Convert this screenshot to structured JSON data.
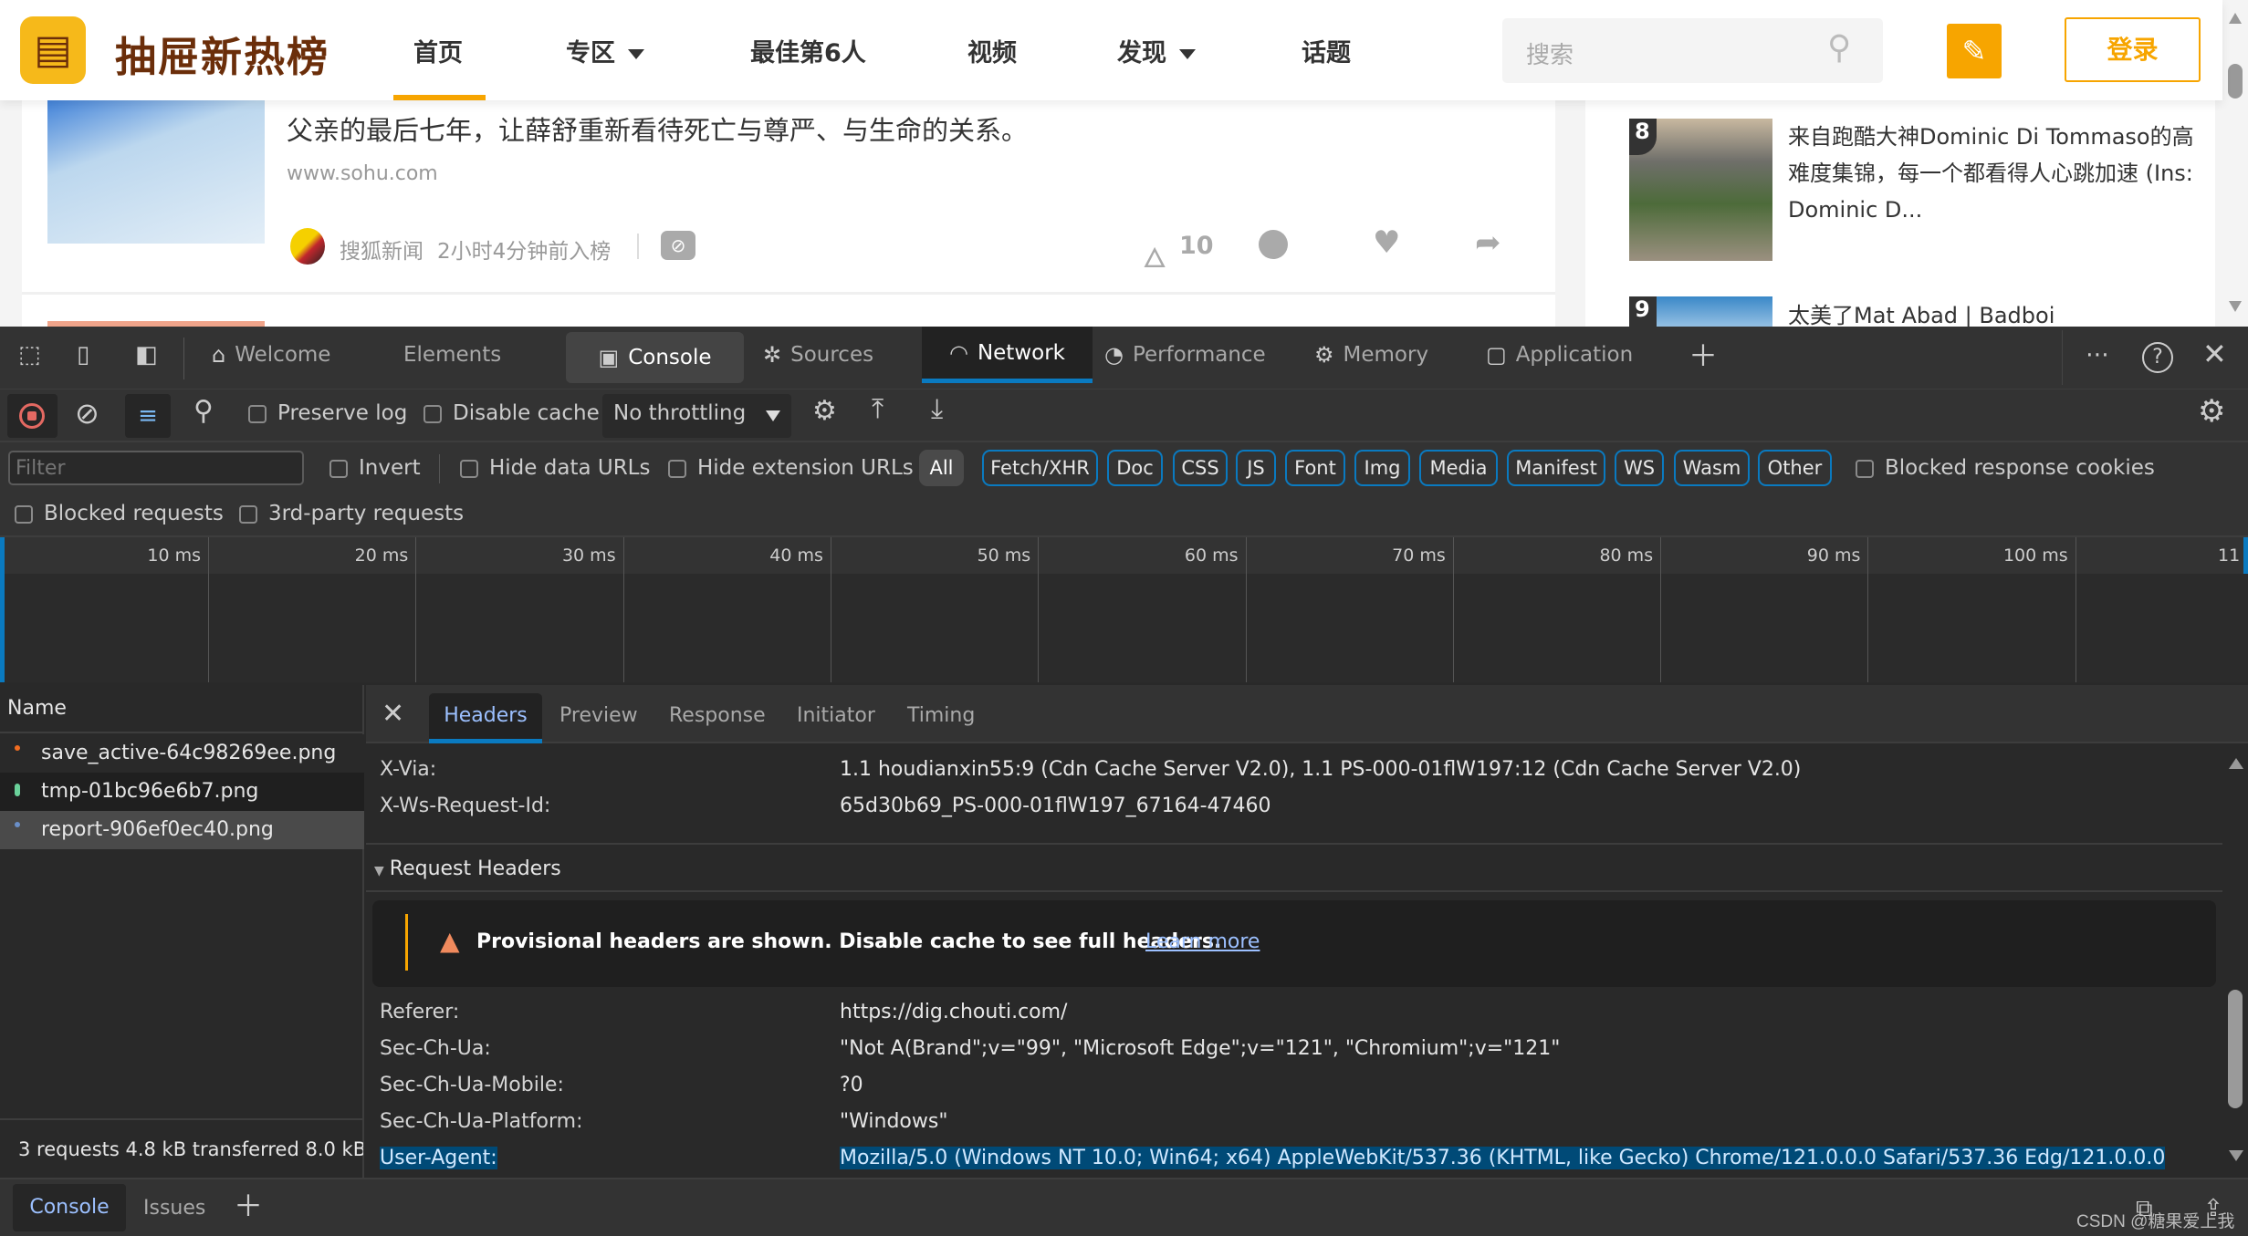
{
  "site": {
    "logo_text": "抽屉新热榜",
    "nav": [
      {
        "label": "首页",
        "active": true
      },
      {
        "label": "专区",
        "dropdown": true
      },
      {
        "label": "最佳第6人"
      },
      {
        "label": "视频"
      },
      {
        "label": "发现",
        "dropdown": true
      },
      {
        "label": "话题"
      }
    ],
    "search_placeholder": "搜索",
    "login_label": "登录",
    "accent_color": "#f7a500",
    "article": {
      "title": "父亲的最后七年，让薛舒重新看待死亡与尊严、与生命的关系。",
      "domain": "www.sohu.com",
      "source": "搜狐新闻",
      "time": "2小时4分钟前入榜",
      "likes": "10"
    },
    "side_items": [
      {
        "rank": "8",
        "title": "来自跑酷大神Dominic Di Tommaso的高难度集锦，每一个都看得人心跳加速 (Ins: Dominic D..."
      },
      {
        "rank": "9",
        "title": "太美了Mat Abad | Badboi"
      }
    ]
  },
  "devtools": {
    "tabs": [
      {
        "label": "Welcome",
        "icon": "home-icon"
      },
      {
        "label": "Elements",
        "icon": "code-icon"
      },
      {
        "label": "Console",
        "icon": "console-warning-icon"
      },
      {
        "label": "Sources",
        "icon": "bug-icon"
      },
      {
        "label": "Network",
        "icon": "wifi-icon",
        "active": true
      },
      {
        "label": "Performance",
        "icon": "gauge-icon"
      },
      {
        "label": "Memory",
        "icon": "chip-icon"
      },
      {
        "label": "Application",
        "icon": "app-icon"
      }
    ],
    "toolbar": {
      "preserve_log": "Preserve log",
      "disable_cache": "Disable cache",
      "throttling": "No throttling"
    },
    "filter": {
      "placeholder": "Filter",
      "invert": "Invert",
      "hide_data_urls": "Hide data URLs",
      "hide_extension_urls": "Hide extension URLs",
      "types": [
        "All",
        "Fetch/XHR",
        "Doc",
        "CSS",
        "JS",
        "Font",
        "Img",
        "Media",
        "Manifest",
        "WS",
        "Wasm",
        "Other"
      ],
      "blocked_response_cookies": "Blocked response cookies",
      "blocked_requests": "Blocked requests",
      "third_party": "3rd-party requests"
    },
    "timeline_ticks": [
      "10 ms",
      "20 ms",
      "30 ms",
      "40 ms",
      "50 ms",
      "60 ms",
      "70 ms",
      "80 ms",
      "90 ms",
      "100 ms",
      "11"
    ],
    "requests": {
      "header": "Name",
      "items": [
        {
          "name": "save_active-64c98269ee.png",
          "status_color": "#f26d21"
        },
        {
          "name": "tmp-01bc96e6b7.png",
          "status_color": "#6ad19a"
        },
        {
          "name": "report-906ef0ec40.png",
          "status_color": "#6a8fc8",
          "selected": true
        }
      ],
      "summary": "3 requests  4.8 kB transferred  8.0 kB"
    },
    "detail_tabs": [
      "Headers",
      "Preview",
      "Response",
      "Initiator",
      "Timing"
    ],
    "response_headers": [
      {
        "name": "X-Via:",
        "value": "1.1 houdianxin55:9 (Cdn Cache Server V2.0), 1.1 PS-000-01flW197:12 (Cdn Cache Server V2.0)"
      },
      {
        "name": "X-Ws-Request-Id:",
        "value": "65d30b69_PS-000-01flW197_67164-47460"
      }
    ],
    "request_section": "Request Headers",
    "provisional": {
      "text": "Provisional headers are shown. Disable cache to see full headers.",
      "link": "Learn more"
    },
    "request_headers": [
      {
        "name": "Referer:",
        "value": "https://dig.chouti.com/"
      },
      {
        "name": "Sec-Ch-Ua:",
        "value": "\"Not A(Brand\";v=\"99\", \"Microsoft Edge\";v=\"121\", \"Chromium\";v=\"121\""
      },
      {
        "name": "Sec-Ch-Ua-Mobile:",
        "value": "?0"
      },
      {
        "name": "Sec-Ch-Ua-Platform:",
        "value": "\"Windows\""
      },
      {
        "name": "User-Agent:",
        "value": "Mozilla/5.0 (Windows NT 10.0; Win64; x64) AppleWebKit/537.36 (KHTML, like Gecko) Chrome/121.0.0.0 Safari/537.36 Edg/121.0.0.0",
        "selected": true
      }
    ],
    "drawer_tabs": [
      "Console",
      "Issues"
    ]
  },
  "watermark": "CSDN @糖果爱上我"
}
